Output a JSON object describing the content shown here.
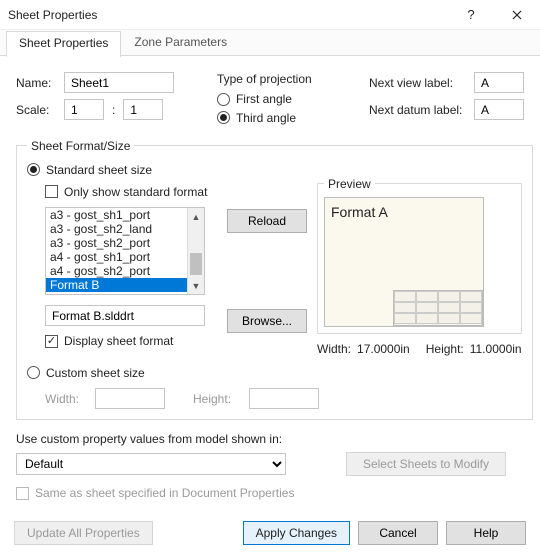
{
  "window": {
    "title": "Sheet Properties"
  },
  "tabs": {
    "sheet_properties": "Sheet Properties",
    "zone_parameters": "Zone Parameters"
  },
  "name": {
    "label": "Name:",
    "value": "Sheet1"
  },
  "scale": {
    "label": "Scale:",
    "num": "1",
    "den": "1",
    "sep": ":"
  },
  "projection": {
    "label": "Type of projection",
    "first": "First angle",
    "third": "Third angle"
  },
  "next_view": {
    "label": "Next view label:",
    "value": "A"
  },
  "next_datum": {
    "label": "Next datum label:",
    "value": "A"
  },
  "format": {
    "legend": "Sheet Format/Size",
    "std_radio": "Standard sheet size",
    "only_std": "Only show standard format",
    "list": [
      "a3 - gost_sh1_port",
      "a3 - gost_sh2_land",
      "a3 - gost_sh2_port",
      "a4 - gost_sh1_port",
      "a4 - gost_sh2_port",
      "Format B"
    ],
    "selected": "Format B",
    "file": "Format B.slddrt",
    "reload": "Reload",
    "browse": "Browse...",
    "display": "Display sheet format",
    "preview_legend": "Preview",
    "preview_title": "Format A",
    "width_label": "Width:",
    "width_value": "17.0000in",
    "height_label": "Height:",
    "height_value": "11.0000in",
    "custom_radio": "Custom sheet size",
    "custom_width": "Width:",
    "custom_height": "Height:"
  },
  "custom_src": {
    "label": "Use custom property values from model shown in:",
    "value": "Default",
    "same_as": "Same as sheet specified in Document Properties",
    "select_sheets": "Select Sheets to Modify"
  },
  "buttons": {
    "update_all": "Update All Properties",
    "apply": "Apply Changes",
    "cancel": "Cancel",
    "help": "Help"
  }
}
